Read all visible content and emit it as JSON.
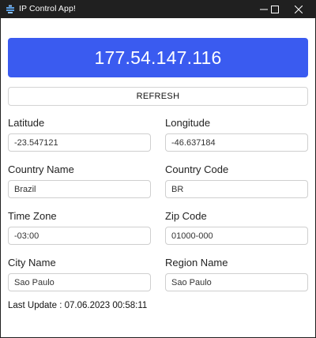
{
  "window": {
    "title": "IP Control App!"
  },
  "ip": "177.54.147.116",
  "refresh_label": "REFRESH",
  "fields": {
    "latitude": {
      "label": "Latitude",
      "value": "-23.547121"
    },
    "longitude": {
      "label": "Longitude",
      "value": "-46.637184"
    },
    "country_name": {
      "label": "Country Name",
      "value": "Brazil"
    },
    "country_code": {
      "label": "Country Code",
      "value": "BR"
    },
    "time_zone": {
      "label": "Time Zone",
      "value": "-03:00"
    },
    "zip_code": {
      "label": "Zip Code",
      "value": "01000-000"
    },
    "city_name": {
      "label": "City Name",
      "value": "Sao Paulo"
    },
    "region_name": {
      "label": "Region Name",
      "value": "Sao Paulo"
    }
  },
  "last_update": "Last Update : 07.06.2023 00:58:11",
  "colors": {
    "accent": "#3a5bf0",
    "titlebar": "#202020"
  }
}
